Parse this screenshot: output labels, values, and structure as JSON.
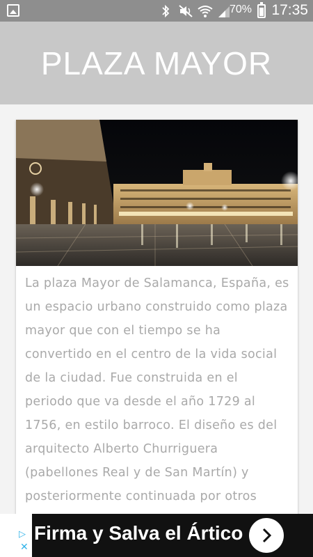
{
  "status_bar": {
    "battery": "70%",
    "time": "17:35",
    "icons": [
      "image-icon",
      "bluetooth-icon",
      "mute-icon",
      "wifi-icon",
      "signal-icon",
      "battery-icon"
    ]
  },
  "header": {
    "title": "PLAZA MAYOR",
    "background": "#c8c8c8"
  },
  "article": {
    "image_alt": "Plaza Mayor de Salamanca de noche",
    "text": "La plaza Mayor de Salamanca, España, es un espacio urbano construido como plaza mayor que con el tiempo se ha convertido en el centro de la vida social de la ciudad. Fue construida en el periodo que va desde el año 1729 al 1756, en estilo barroco. El diseño es del arquitecto Alberto Churriguera (pabellones Real y de San Martín) y posteriormente continuada por otros"
  },
  "ad": {
    "text": "Firma y Salva el Ártico",
    "choices_glyph": "▷",
    "close_glyph": "✕"
  }
}
